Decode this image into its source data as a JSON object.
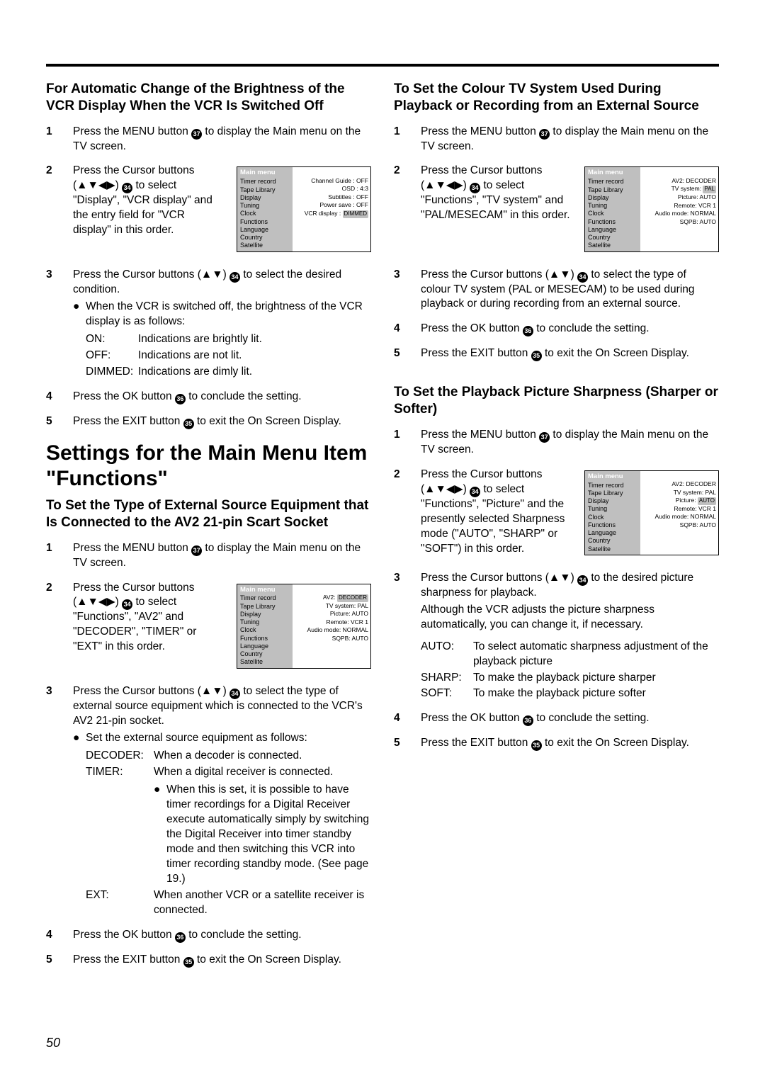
{
  "page_number": "50",
  "left": {
    "h3": "For Automatic Change of the Brightness of the VCR Display When the VCR Is Switched Off",
    "s1": {
      "n": "1",
      "t": "Press the MENU button ",
      "t2": " to display the Main menu on the TV screen.",
      "ref": "37"
    },
    "s2": {
      "n": "2",
      "t": "Press the Cursor buttons (▲▼◀▶) ",
      "t2": " to select \"Display\", \"VCR display\" and the entry field for \"VCR display\" in this order.",
      "ref": "34"
    },
    "s3": {
      "n": "3",
      "t": "Press the Cursor buttons (▲▼) ",
      "t2": " to select the desired condition.",
      "ref": "34"
    },
    "s3b": "When the VCR is switched off, the brightness of the VCR display is as follows:",
    "s3d1k": "ON:",
    "s3d1v": "Indications are brightly lit.",
    "s3d2k": "OFF:",
    "s3d2v": "Indications are not lit.",
    "s3d3k": "DIMMED:",
    "s3d3v": "Indications are dimly lit.",
    "s4": {
      "n": "4",
      "t": "Press the OK button ",
      "t2": " to conclude the setting.",
      "ref": "36"
    },
    "s5": {
      "n": "5",
      "t": "Press the EXIT button ",
      "t2": " to exit the On Screen Display.",
      "ref": "35"
    },
    "h1": "Settings for the Main Menu Item \"Functions\"",
    "h2": "To Set the Type of External Source Equipment that Is Connected to the AV2 21-pin Scart Socket",
    "b1": {
      "n": "1",
      "t": "Press the MENU button ",
      "t2": " to display the Main menu on the TV screen.",
      "ref": "37"
    },
    "b2": {
      "n": "2",
      "t": "Press the Cursor buttons (▲▼◀▶) ",
      "t2": " to select \"Functions\", \"AV2\" and \"DECODER\", \"TIMER\" or \"EXT\" in this order.",
      "ref": "34"
    },
    "b3": {
      "n": "3",
      "t": "Press the Cursor buttons (▲▼) ",
      "t2": " to select the type of external source equipment which is connected to the VCR's AV2 21-pin socket.",
      "ref": "34"
    },
    "b3b": "Set the external source equipment as follows:",
    "b3d1k": "DECODER:",
    "b3d1v": "When a decoder is connected.",
    "b3d2k": "TIMER:",
    "b3d2v": "When a digital receiver is connected.",
    "b3d2b": "When this is set, it is possible to have timer recordings for a Digital Receiver execute automatically simply by switching the Digital Receiver into timer standby mode and then switching this VCR into timer recording standby mode. (See page 19.)",
    "b3d3k": "EXT:",
    "b3d3v": "When another VCR or a satellite receiver is connected.",
    "b4": {
      "n": "4",
      "t": "Press the OK button ",
      "t2": " to conclude the setting.",
      "ref": "36"
    },
    "b5": {
      "n": "5",
      "t": "Press the EXIT button ",
      "t2": " to exit the On Screen Display.",
      "ref": "35"
    }
  },
  "right": {
    "h3": "To Set the Colour TV System Used During Playback or Recording from an External Source",
    "s1": {
      "n": "1",
      "t": "Press the MENU button ",
      "t2": " to display the Main menu on the TV screen.",
      "ref": "37"
    },
    "s2": {
      "n": "2",
      "t": "Press the Cursor buttons (▲▼◀▶) ",
      "t2": " to select \"Functions\", \"TV system\" and \"PAL/MESECAM\" in this order.",
      "ref": "34"
    },
    "s3": {
      "n": "3",
      "t": "Press the Cursor buttons (▲▼) ",
      "t2": " to select the type of colour TV system (PAL or MESECAM) to be used during playback or during recording from an external source.",
      "ref": "34"
    },
    "s4": {
      "n": "4",
      "t": "Press the OK button ",
      "t2": " to conclude the setting.",
      "ref": "36"
    },
    "s5": {
      "n": "5",
      "t": "Press the EXIT button ",
      "t2": " to exit the On Screen Display.",
      "ref": "35"
    },
    "h2": "To Set the Playback Picture Sharpness (Sharper or Softer)",
    "p1": {
      "n": "1",
      "t": "Press the MENU button ",
      "t2": " to display the Main menu on the TV screen.",
      "ref": "37"
    },
    "p2": {
      "n": "2",
      "t": "Press the Cursor buttons (▲▼◀▶) ",
      "t2": " to select \"Functions\", \"Picture\" and the presently selected Sharpness mode (\"AUTO\", \"SHARP\" or \"SOFT\") in this order.",
      "ref": "34"
    },
    "p3": {
      "n": "3",
      "t": "Press the Cursor buttons (▲▼) ",
      "t2": " to the desired picture sharpness for playback.",
      "ref": "34"
    },
    "p3b": "Although the VCR adjusts the picture sharpness automatically, you can change it, if necessary.",
    "p3d1k": "AUTO:",
    "p3d1v": "To select automatic sharpness adjustment of the playback picture",
    "p3d2k": "SHARP:",
    "p3d2v": "To make the playback picture sharper",
    "p3d3k": "SOFT:",
    "p3d3v": "To make the playback picture softer",
    "p4": {
      "n": "4",
      "t": "Press the OK button ",
      "t2": " to conclude the setting.",
      "ref": "36"
    },
    "p5": {
      "n": "5",
      "t": "Press the EXIT button ",
      "t2": " to exit the On Screen Display.",
      "ref": "35"
    }
  },
  "osd": {
    "title": "Main menu",
    "menu": [
      "Timer record",
      "Tape Library",
      "Display",
      "Tuning",
      "Clock",
      "Functions",
      "Language",
      "Country",
      "Satellite"
    ],
    "display_vals": [
      "Channel Guide : OFF",
      "OSD : 4:3",
      "Subtitles : OFF",
      "Power save : OFF",
      "VCR display : DIMMED"
    ],
    "func_av2_hi": "DECODER",
    "func_av2": "AV2: ",
    "func_pal_hi": "PAL",
    "func_tv": "TV system: ",
    "func_auto_hi": "AUTO",
    "func_pic": "Picture: ",
    "func_vals_rest": [
      "Remote: VCR 1",
      "Audio mode: NORMAL",
      "SQPB: AUTO"
    ],
    "func_tv_plain": "TV system: PAL",
    "func_pic_plain": "Picture: AUTO"
  }
}
